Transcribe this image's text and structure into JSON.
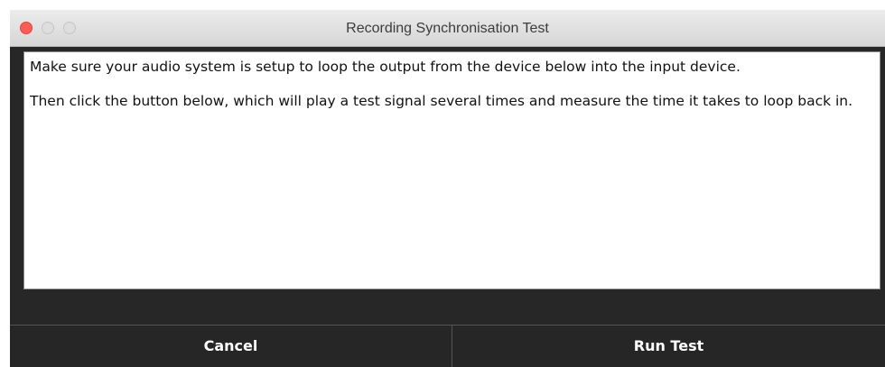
{
  "window": {
    "title": "Recording Synchronisation Test"
  },
  "message": {
    "paragraph1": "Make sure your audio system is setup to loop the output from the device below into the input device.",
    "paragraph2": "Then click the button below, which will play a test signal several times and measure the time it takes to loop back in."
  },
  "buttons": {
    "cancel_label": "Cancel",
    "run_label": "Run Test"
  },
  "colors": {
    "window_background": "#272727",
    "close_button": "#fc5c56",
    "button_text": "#ffffff"
  },
  "icons": {
    "close": "close-traffic-light-icon",
    "minimize": "minimize-traffic-light-icon",
    "zoom": "zoom-traffic-light-icon"
  }
}
